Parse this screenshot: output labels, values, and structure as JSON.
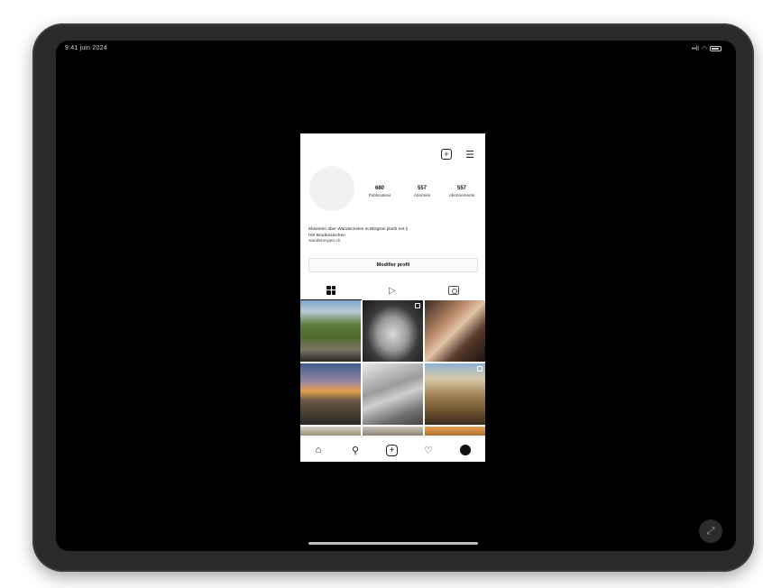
{
  "device": {
    "status_time": "9:41 juin 2024",
    "status_signal": "••ll",
    "status_wifi": "◠"
  },
  "profile": {
    "username": "",
    "stats": [
      {
        "value": "680",
        "label": "Publications"
      },
      {
        "value": "557",
        "label": "Abonnés"
      },
      {
        "value": "557",
        "label": "Abonnements"
      }
    ],
    "bio_line1": "Ekkentrin über Wanderzielen et Bilsgrün plutôt ent li",
    "bio_line2": "Hirt Brudenzeichen",
    "bio_tag": "wanderungen.ch",
    "edit_label": "Modifier profil"
  },
  "icons": {
    "new_post": "plus-square-icon",
    "menu": "menu-icon",
    "grid_tab": "grid-icon",
    "reels_tab": "play-icon",
    "tagged_tab": "tagged-icon",
    "home": "home-icon",
    "search": "search-icon",
    "add": "add-icon",
    "activity": "heart-icon",
    "profile": "profile-icon"
  },
  "colors": {
    "screen_bg": "#000000",
    "app_bg": "#ffffff",
    "text": "#111111"
  }
}
